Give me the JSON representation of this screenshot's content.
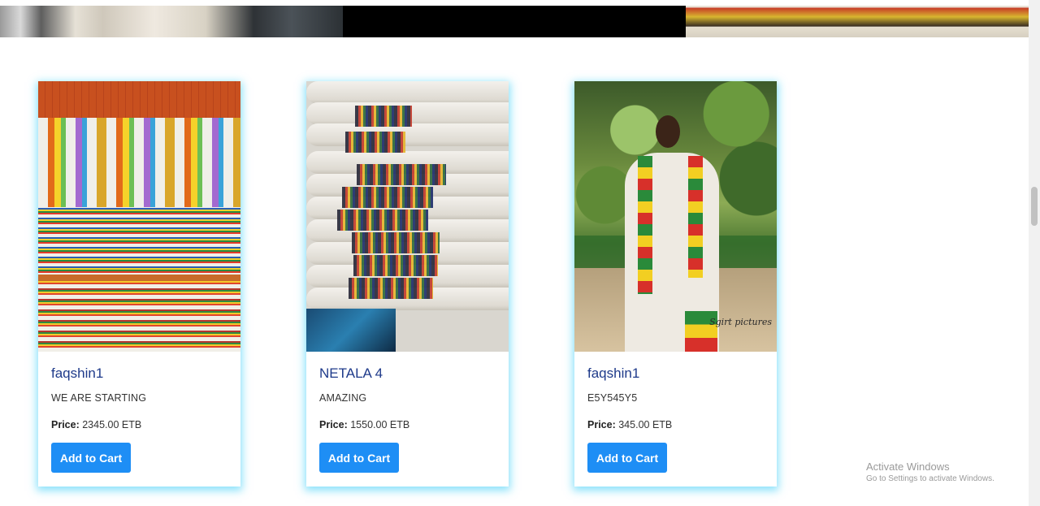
{
  "cards": [
    {
      "title": "faqshin1",
      "description": "WE ARE STARTING",
      "price_label": "Price:",
      "price_value": "2345.00 ETB",
      "button_label": "Add to Cart"
    },
    {
      "title": "NETALA 4",
      "description": "AMAZING",
      "price_label": "Price:",
      "price_value": "1550.00 ETB",
      "button_label": "Add to Cart"
    },
    {
      "title": "faqshin1",
      "description": "E5Y545Y5",
      "price_label": "Price:",
      "price_value": "345.00 ETB",
      "button_label": "Add to Cart",
      "image_watermark": "Sgirt pictures"
    }
  ],
  "watermark": {
    "line1": "Activate Windows",
    "line2": "Go to Settings to activate Windows."
  },
  "colors": {
    "button": "#1e8ef5",
    "title": "#1e3a8a",
    "card_glow": "#28c8f5"
  }
}
